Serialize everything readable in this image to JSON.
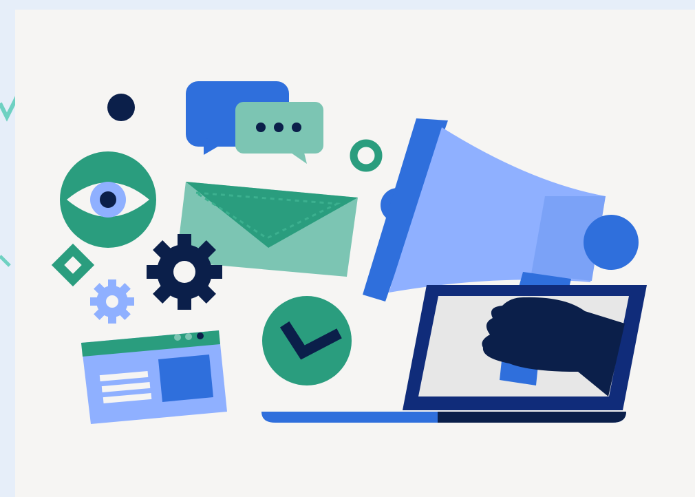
{
  "illustration": {
    "palette": {
      "background_outer": "#e6eef9",
      "background_card": "#f6f5f3",
      "blue_dark": "#0b1f4a",
      "blue_mid": "#2f6fdc",
      "blue_light": "#8fb0ff",
      "teal": "#2a9d7e",
      "teal_light": "#7cc5b3",
      "navy": "#0b1f4a",
      "gray": "#e7e7e7",
      "white": "#ffffff"
    },
    "icons": [
      "megaphone-icon",
      "laptop-icon",
      "hand-icon",
      "envelope-icon",
      "eye-icon",
      "chat-bubble-icon",
      "typing-bubble-icon",
      "gear-icon",
      "small-gear-icon",
      "check-circle-icon",
      "browser-window-icon",
      "ring-icon",
      "dot-icon",
      "diamond-icon"
    ]
  }
}
